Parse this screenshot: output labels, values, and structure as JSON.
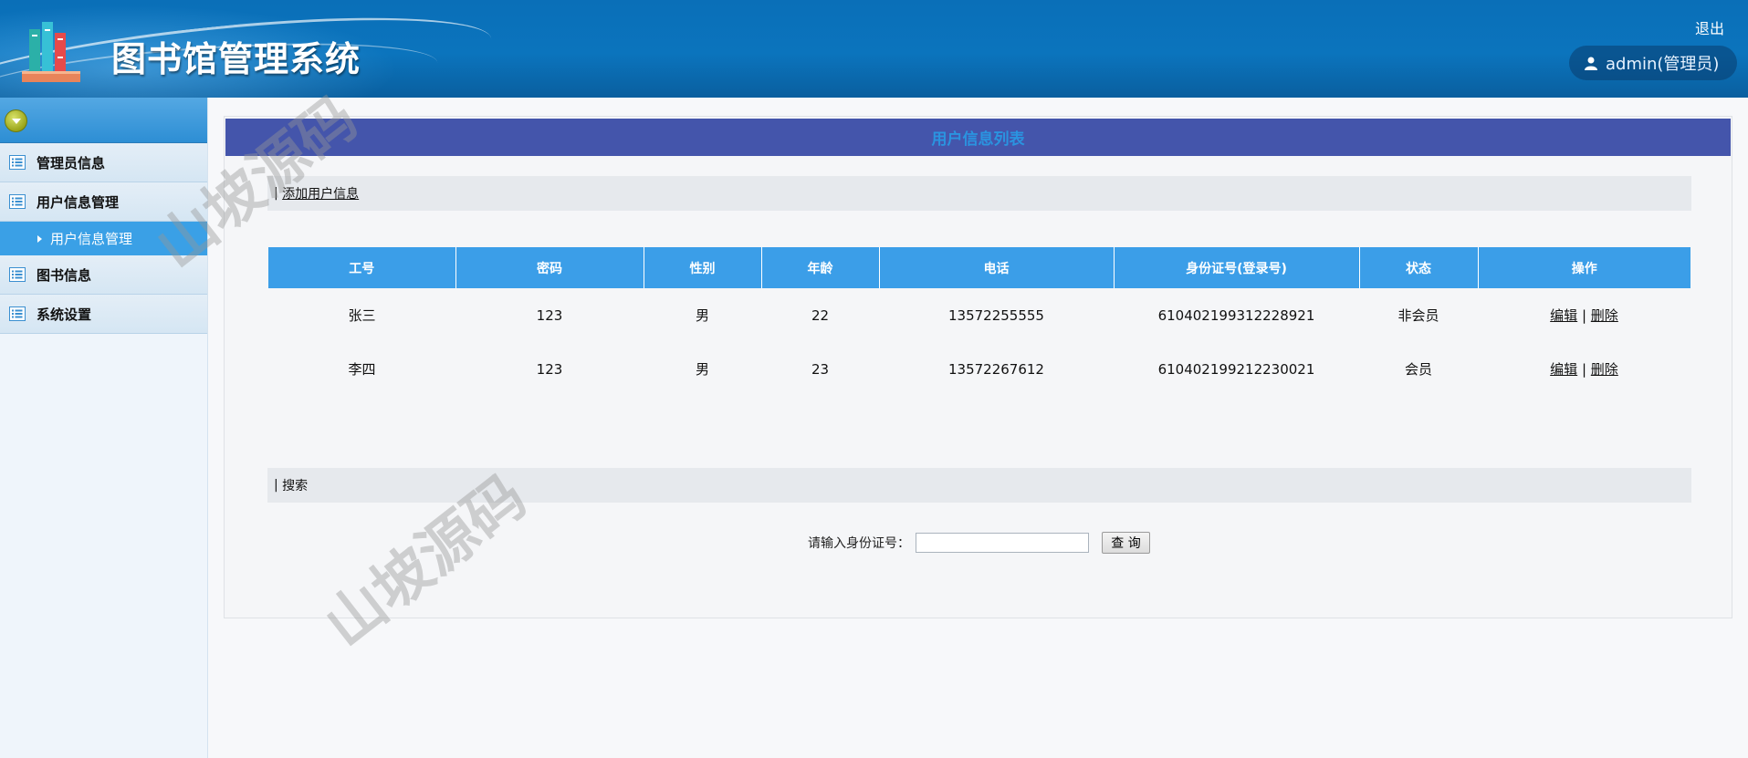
{
  "header": {
    "title": "图书馆管理系统",
    "logout_label": "退出",
    "user_label": "admin(管理员)"
  },
  "sidebar": {
    "items": [
      {
        "label": "管理员信息"
      },
      {
        "label": "用户信息管理"
      },
      {
        "label": "用户信息管理"
      },
      {
        "label": "图书信息"
      },
      {
        "label": "系统设置"
      }
    ]
  },
  "main": {
    "panel_title": "用户信息列表",
    "add_link": "添加用户信息",
    "table": {
      "columns": [
        "工号",
        "密码",
        "性别",
        "年龄",
        "电话",
        "身份证号(登录号)",
        "状态",
        "操作"
      ],
      "rows": [
        {
          "cells": [
            "张三",
            "123",
            "男",
            "22",
            "13572255555",
            "610402199312228921",
            "非会员"
          ],
          "edit": "编辑",
          "delete": "删除"
        },
        {
          "cells": [
            "李四",
            "123",
            "男",
            "23",
            "13572267612",
            "610402199212230021",
            "会员"
          ],
          "edit": "编辑",
          "delete": "删除"
        }
      ]
    },
    "search_bar_label": "搜索",
    "search_field_label": "请输入身份证号：",
    "search_value": "",
    "search_button": "查 询"
  },
  "watermark": "山坡源码",
  "colors": {
    "header_blue": "#0a6fb8",
    "title_bar": "#4455ab",
    "table_header": "#3b9ee8",
    "active_nav": "#3aa0e6"
  }
}
